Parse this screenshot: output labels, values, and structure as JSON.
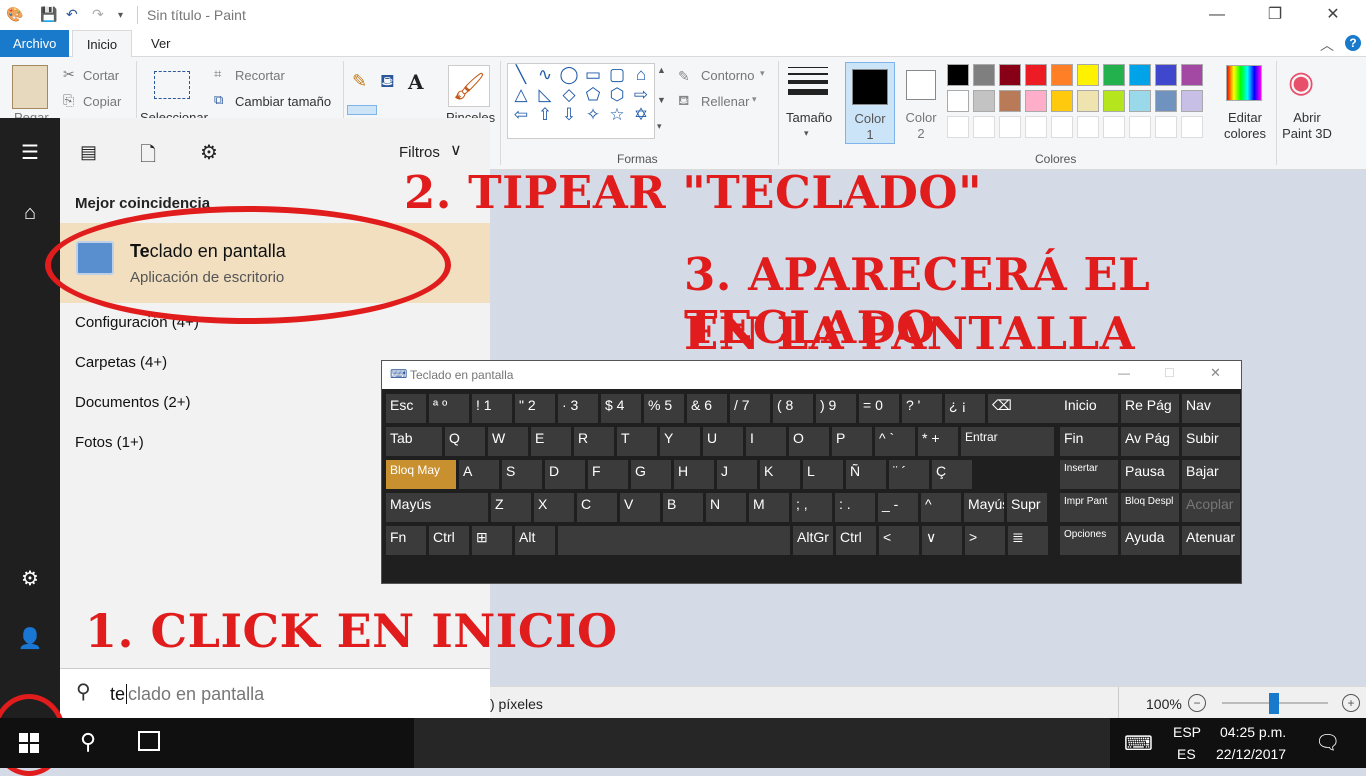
{
  "paint": {
    "window_title": "Sin título - Paint",
    "tabs": [
      "Archivo",
      "Inicio",
      "Ver"
    ],
    "clipboard": {
      "paste": "Pegar",
      "cut": "Cortar",
      "copy": "Copiar"
    },
    "image": {
      "select": "Seleccionar",
      "crop": "Recortar",
      "resize": "Cambiar tamaño"
    },
    "tools": {
      "brushes": "Pinceles"
    },
    "shapes": {
      "outline": "Contorno",
      "fill": "Rellenar",
      "group_label": "Formas"
    },
    "size_label": "Tamaño",
    "color1": "Color 1",
    "color2": "Color 2",
    "colors_group_label": "Colores",
    "edit_colors": "Editar colores",
    "open_paint3d": "Abrir Paint 3D",
    "status_size": ") píxeles",
    "zoom": "100%",
    "palette_row1": [
      "#000000",
      "#7f7f7f",
      "#880015",
      "#ed1c24",
      "#ff7f27",
      "#fff200",
      "#22b14c",
      "#00a2e8",
      "#3f48cc",
      "#a349a4"
    ],
    "palette_row2": [
      "#ffffff",
      "#c3c3c3",
      "#b97a57",
      "#ffaec9",
      "#ffc90e",
      "#efe4b0",
      "#b5e61d",
      "#99d9ea",
      "#7092be",
      "#c8bfe7"
    ]
  },
  "start_menu": {
    "filters_label": "Filtros",
    "best_match_heading": "Mejor coincidencia",
    "best_match": {
      "title_bold": "Te",
      "title_rest": "clado en pantalla",
      "subtitle": "Aplicación de escritorio"
    },
    "categories": [
      "Configuración (4+)",
      "Carpetas (4+)",
      "Documentos (2+)",
      "Fotos (1+)"
    ],
    "search_typed": "te",
    "search_suggestion": "clado en pantalla"
  },
  "annotations": {
    "step1": "1. CLICK EN INICIO",
    "step2": "2. TIPEAR \"TECLADO\"",
    "step3_line1": "3. APARECERÁ EL TECLADO",
    "step3_line2": "EN LA PANTALLA"
  },
  "osk": {
    "title": "Teclado en pantalla",
    "row1": [
      "Esc",
      "ª º",
      "! 1",
      "\" 2",
      "· 3",
      "$ 4",
      "% 5",
      "& 6",
      "/ 7",
      "( 8",
      ") 9",
      "= 0",
      "? '",
      "¿ ¡",
      "⌫"
    ],
    "row2": [
      "Tab",
      "Q",
      "W",
      "E",
      "R",
      "T",
      "Y",
      "U",
      "I",
      "O",
      "P",
      "^ `",
      "* +",
      "Entrar"
    ],
    "row3": [
      "Bloq May",
      "A",
      "S",
      "D",
      "F",
      "G",
      "H",
      "J",
      "K",
      "L",
      "Ñ",
      "¨ ´",
      "Ç"
    ],
    "row4": [
      "Mayús",
      "Z",
      "X",
      "C",
      "V",
      "B",
      "N",
      "M",
      "; ,",
      ": .",
      "_ -",
      "^",
      "Mayús",
      "Supr"
    ],
    "row5": [
      "Fn",
      "Ctrl",
      "⊞",
      "Alt",
      "",
      "AltGr",
      "Ctrl",
      "<",
      "∨",
      ">",
      "≣"
    ],
    "nav_keys": [
      "Inicio",
      "Re Pág",
      "Nav",
      "Fin",
      "Av Pág",
      "Subir",
      "Insertar",
      "Pausa",
      "Bajar",
      "Impr Pant",
      "Bloq Despl",
      "Acoplar",
      "Opciones",
      "Ayuda",
      "Atenuar"
    ]
  },
  "taskbar": {
    "lang1": "ESP",
    "lang2": "ES",
    "time": "04:25 p.m.",
    "date": "22/12/2017"
  }
}
